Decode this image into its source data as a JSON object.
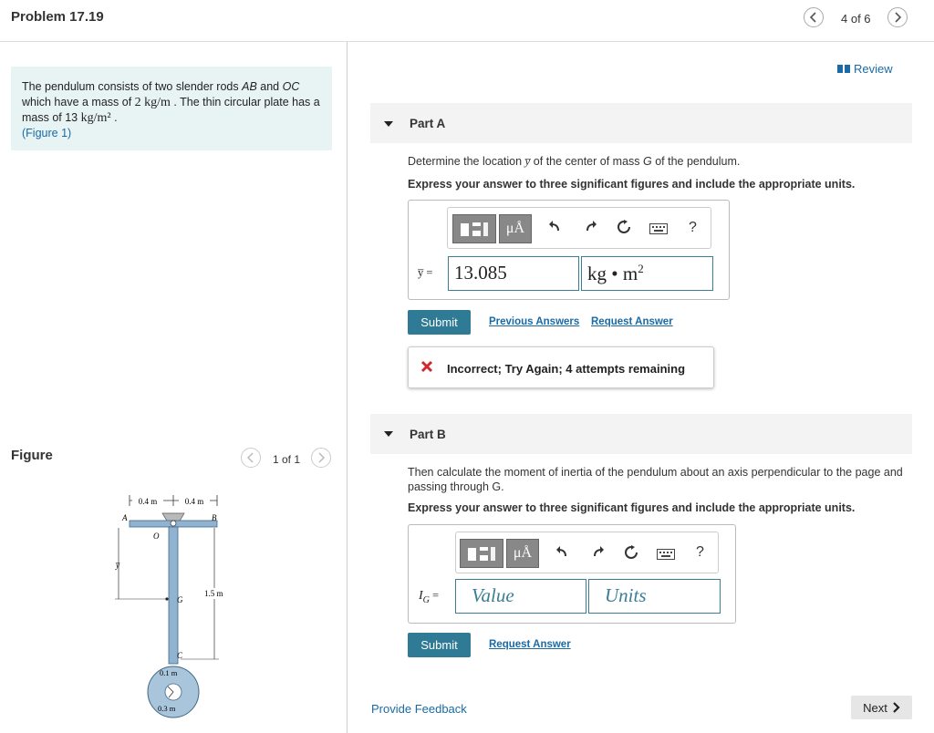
{
  "header": {
    "title": "Problem 17.19",
    "page_indicator": "4 of 6",
    "prev_icon": "chevron-left-icon",
    "next_icon": "chevron-right-icon"
  },
  "problem": {
    "text_1": "The pendulum consists of two slender rods ",
    "rod_ab": "AB",
    "text_2": " and ",
    "rod_oc": "OC",
    "text_3": " which have a mass of ",
    "rod_mass": "2 kg/m",
    "text_4": " . The thin circular plate has a mass of 13 ",
    "plate_mass_unit": "kg/m²",
    "text_5": " .",
    "figure_link": "Figure 1",
    "paren_open": "(",
    "paren_close": ")"
  },
  "figure": {
    "label": "Figure",
    "pager": "1 of 1",
    "labels": {
      "dim_left": "0.4 m",
      "dim_right": "0.4 m",
      "A": "A",
      "B": "B",
      "O": "O",
      "G": "G",
      "C": "C",
      "ybar": "y̅",
      "length": "1.5 m",
      "inner_r": "0.1 m",
      "outer_r": "0.3 m"
    }
  },
  "review": {
    "label": "Review",
    "icon": "book-icon"
  },
  "partA": {
    "label": "Part A",
    "prompt_1": "Determine the location ",
    "prompt_var": "y̅",
    "prompt_2": " of the center of mass ",
    "prompt_G": "G",
    "prompt_3": " of the pendulum.",
    "instruction": "Express your answer to three significant figures and include the appropriate units.",
    "var_label": "y̅ =",
    "value": "13.085",
    "units": "kg • m",
    "units_exp": "2",
    "submit": "Submit",
    "previous_answers": "Previous Answers",
    "request_answer": "Request Answer",
    "feedback": "Incorrect; Try Again; 4 attempts remaining"
  },
  "toolbar": {
    "mu_label": "μÅ",
    "help": "?"
  },
  "partB": {
    "label": "Part B",
    "prompt": "Then calculate the moment of inertia of the pendulum about an axis perpendicular to the page and passing through G.",
    "instruction": "Express your answer to three significant figures and include the appropriate units.",
    "var_label": "I",
    "var_sub": "G",
    "var_eq": " =",
    "value_placeholder": "Value",
    "units_placeholder": "Units",
    "submit": "Submit",
    "request_answer": "Request Answer"
  },
  "footer": {
    "provide_feedback": "Provide Feedback",
    "next": "Next"
  },
  "colors": {
    "accent": "#2f7a94",
    "link": "#1a6aa5",
    "problem_bg": "#e8f4f4",
    "error": "#d0282e"
  }
}
